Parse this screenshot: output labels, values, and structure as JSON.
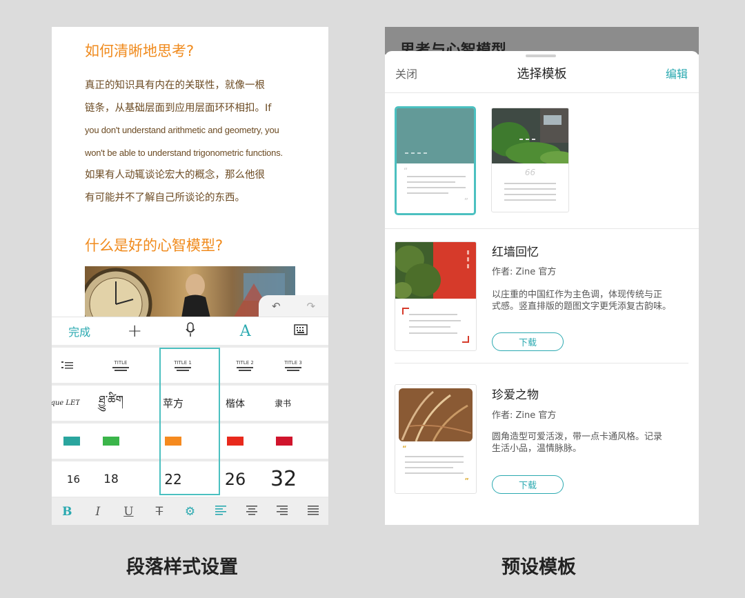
{
  "left_panel": {
    "heading1": "如何清晰地思考?",
    "para1_lines": [
      "真正的知识具有内在的关联性，就像一根",
      "链条，从基础层面到应用层面环环相扣。If",
      "you don't understand arithmetic and geometry, you",
      "won't be able to understand trigonometric functions.",
      "如果有人动辄谈论宏大的概念，那么他很",
      "有可能并不了解自己所谈论的东西。"
    ],
    "heading2": "什么是好的心智模型?",
    "undo_icon": "undo-icon",
    "redo_icon": "redo-icon",
    "toolbar": {
      "done_label": "完成",
      "plus_icon": "+",
      "mic_icon": "microphone-icon",
      "font_label": "A",
      "keyboard_icon": "keyboard-icon"
    },
    "title_styles": [
      "TITLE",
      "TITLE 1",
      "TITLE 2",
      "TITLE 3"
    ],
    "fonts": [
      "Baroque LET",
      "ཐྱུ་ཚིག",
      "苹方",
      "楷体",
      "隶书"
    ],
    "colors": [
      "#2aa59e",
      "#3bb54a",
      "#f58a1f",
      "#e8291c",
      "#d0142c"
    ],
    "sizes": [
      "16",
      "18",
      "22",
      "26",
      "32"
    ],
    "format_bar": [
      "B",
      "I",
      "U",
      "T",
      "gear-icon",
      "align-left-icon",
      "align-center-icon",
      "align-right-icon",
      "align-justify-icon"
    ],
    "caption": "段落样式设置"
  },
  "right_panel": {
    "behind_title": "思考与心智模型",
    "close_label": "关闭",
    "sheet_title": "选择模板",
    "edit_label": "编辑",
    "templates": [
      {
        "name": "红墙回忆",
        "author": "作者: Zine 官方",
        "desc_lines": [
          "以庄重的中国红作为主色调，体现传统与正",
          "式感。竖直排版的题图文字更凭添复古韵味。"
        ],
        "button": "下载"
      },
      {
        "name": "珍爱之物",
        "author": "作者: Zine 官方",
        "desc_lines": [
          "圆角造型可爱活泼，带一点卡通风格。记录",
          "生活小品，温情脉脉。"
        ],
        "button": "下载"
      }
    ],
    "quote_mark": "66",
    "caption": "预设模板"
  },
  "accent_color": "#2aa9b0",
  "heading_color": "#f08a1c"
}
